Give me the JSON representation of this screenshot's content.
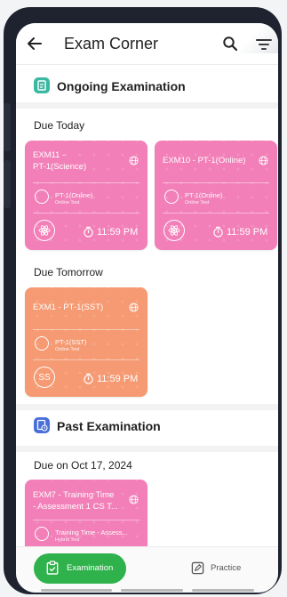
{
  "header": {
    "title": "Exam Corner"
  },
  "ongoing": {
    "title": "Ongoing Examination",
    "groups": [
      {
        "due": "Due Today",
        "cards": [
          {
            "code": "EXM11 -",
            "code2": "PT-1(Science)",
            "subject": "PT-1(Online)",
            "type": "Online Test",
            "badge": "",
            "time": "11:59 PM",
            "color": "#f27fb8"
          },
          {
            "code": "EXM10 - PT-1(Online)",
            "code2": "",
            "subject": "PT-1(Online)",
            "type": "Online Test",
            "badge": "",
            "time": "11:59 PM",
            "color": "#f27fb8"
          }
        ]
      },
      {
        "due": "Due Tomorrow",
        "cards": [
          {
            "code": "EXM1 - PT-1(SST)",
            "code2": "",
            "subject": "PT-1(SST)",
            "type": "Online Test",
            "badge": "SS",
            "time": "11:59 PM",
            "color": "#f59a72"
          }
        ]
      }
    ]
  },
  "past": {
    "title": "Past Examination",
    "groups": [
      {
        "due": "Due on Oct 17, 2024",
        "cards": [
          {
            "code": "EXM7 - Training Time",
            "code2": "- Assessment 1 CS T...",
            "subject": "Training Time - Assess...",
            "type": "Hybrid Test",
            "color": "#f27fb8"
          }
        ]
      }
    ]
  },
  "bottom_nav": {
    "examination": "Examination",
    "practice": "Practice"
  },
  "colors": {
    "green": "#2fb24c",
    "pink": "#f27fb8",
    "orange": "#f59a72",
    "teal_icon": "#3bb8a2",
    "blue_icon": "#4a6fd8"
  },
  "icons": [
    "back-arrow-icon",
    "search-icon",
    "filter-icon",
    "ongoing-exam-icon",
    "past-exam-icon",
    "globe-icon",
    "test-icon",
    "science-icon",
    "timer-icon",
    "clipboard-icon",
    "edit-icon"
  ]
}
